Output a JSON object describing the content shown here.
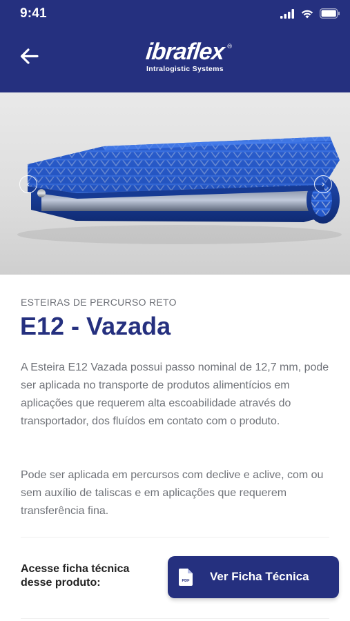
{
  "status_bar": {
    "time": "9:41"
  },
  "header": {
    "back_icon": "arrow-left-icon",
    "logo": {
      "wordmark": "ibraflex",
      "registered": "®",
      "tagline": "Intralogistic Systems"
    },
    "background": "#25307f"
  },
  "hero": {
    "image_subject": "blue modular conveyor belt",
    "prev_icon": "chevron-left-icon",
    "next_icon": "chevron-right-icon"
  },
  "product": {
    "category": "ESTEIRAS DE PERCURSO RETO",
    "name": "E12 - Vazada",
    "description_1": "A Esteira E12 Vazada possui passo nominal de 12,7 mm, pode ser aplicada no transporte de produtos alimentícios em aplicações que requerem alta escoabilidade através do transportador, dos fluídos em contato com o produto.",
    "description_2": "Pode ser aplicada em percursos com declive e aclive, com ou sem auxílio de taliscas e em aplicações que requerem transferência fina."
  },
  "datasheet": {
    "prompt": "Acesse ficha técnica desse produto:",
    "button_label": "Ver Ficha Técnica",
    "button_icon": "pdf-file-icon",
    "pdf_badge": "PDF"
  },
  "colors": {
    "brand": "#25307f",
    "belt_blue": "#1f4fb8",
    "text_muted": "#6f7278"
  }
}
